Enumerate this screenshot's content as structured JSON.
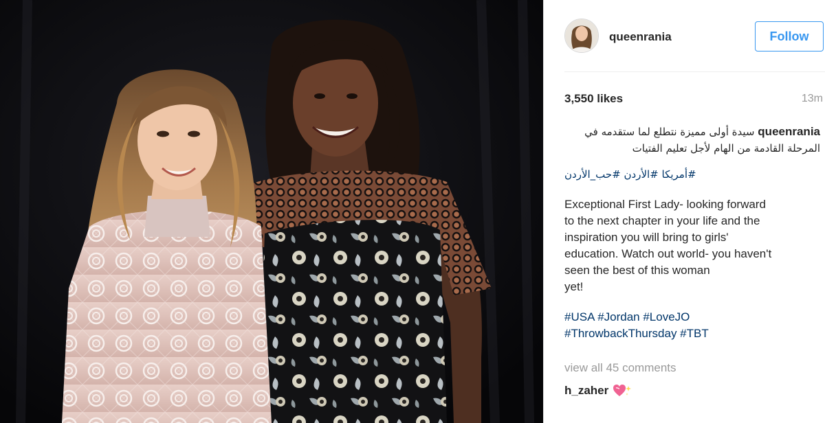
{
  "post": {
    "photo_alt": "",
    "colors": {
      "accent": "#3897f0",
      "hashtag": "#003569",
      "muted": "#999999",
      "text": "#262626",
      "photo_background": "#0b0b0e"
    }
  },
  "header": {
    "username": "queenrania",
    "follow_label": "Follow"
  },
  "stats": {
    "likes": "3,550 likes",
    "timestamp": "13m"
  },
  "caption": {
    "username": "queenrania",
    "arabic_text": "سيدة أولى مميزة نتطلع لما ستقدمه في المرحلة القادمة من الهام لأجل تعليم الفتيات",
    "arabic_hashtags": "#أمريكا #الأردن #حب_الأردن",
    "english_text": "Exceptional First Lady- looking forward\nto the next chapter in your life and the\ninspiration you will bring to girls'\neducation. Watch out world- you haven't\nseen the best of this woman\nyet!",
    "hashtags_line1": "#USA #Jordan #LoveJO",
    "hashtags_line2": "#ThrowbackThursday #TBT"
  },
  "comments": {
    "view_all": "view all 45 comments",
    "items": [
      {
        "user": "h_zaher",
        "emoji_icon": "sparkling-heart-icon"
      }
    ]
  }
}
